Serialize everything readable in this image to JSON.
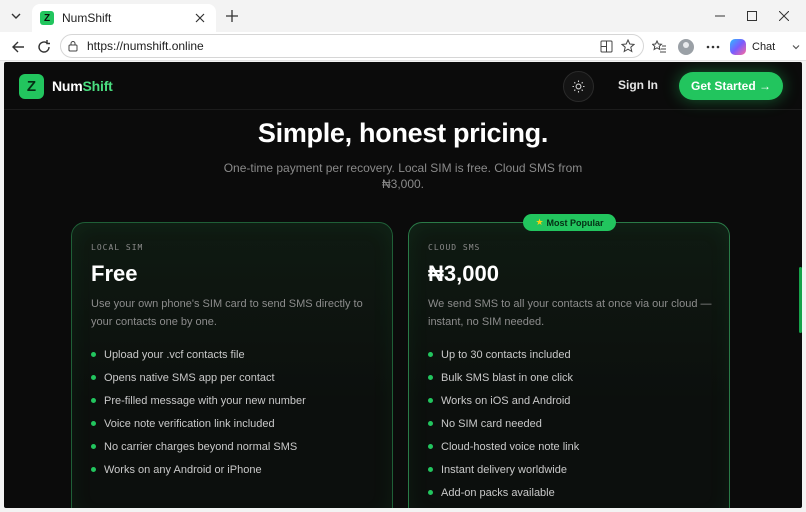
{
  "browser": {
    "tab_title": "NumShift",
    "url": "https://numshift.online",
    "chat_label": "Chat"
  },
  "site": {
    "logo_mark": "Z",
    "brand_part1": "Num",
    "brand_part2": "Shift",
    "sign_in": "Sign In",
    "get_started": "Get Started →",
    "accent_color": "#22c55e"
  },
  "hero": {
    "title": "Simple, honest pricing.",
    "subtitle": "One-time payment per recovery. Local SIM is free. Cloud SMS from ₦3,000."
  },
  "plans": [
    {
      "eyebrow": "LOCAL SIM",
      "price": "Free",
      "description": "Use your own phone's SIM card to send SMS directly to your contacts one by one.",
      "features": [
        "Upload your .vcf contacts file",
        "Opens native SMS app per contact",
        "Pre-filled message with your new number",
        "Voice note verification link included",
        "No carrier charges beyond normal SMS",
        "Works on any Android or iPhone"
      ]
    },
    {
      "eyebrow": "CLOUD SMS",
      "price": "₦3,000",
      "badge": "Most Popular",
      "description": "We send SMS to all your contacts at once via our cloud — instant, no SIM needed.",
      "features": [
        "Up to 30 contacts included",
        "Bulk SMS blast in one click",
        "Works on iOS and Android",
        "No SIM card needed",
        "Cloud-hosted voice note link",
        "Instant delivery worldwide",
        "Add-on packs available"
      ]
    }
  ]
}
